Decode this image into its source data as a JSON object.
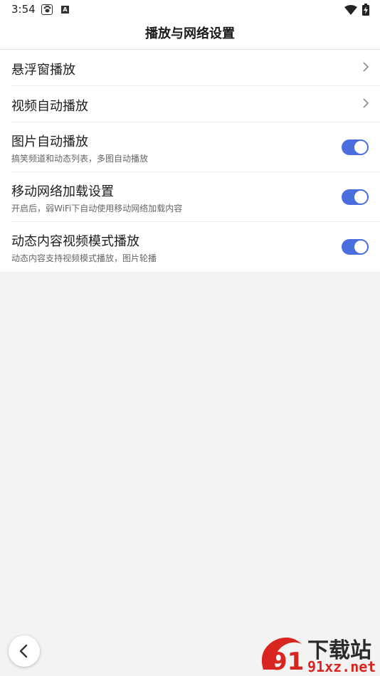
{
  "status_bar": {
    "time": "3:54",
    "app_icon_1": "baidu-paw-icon",
    "app_icon_2": "a-letter-icon",
    "app_icon_2_text": "A",
    "wifi_icon": "wifi-icon",
    "battery_icon": "battery-charging-icon"
  },
  "header": {
    "title": "播放与网络设置"
  },
  "settings": {
    "items": [
      {
        "label": "悬浮窗播放",
        "type": "nav"
      },
      {
        "label": "视频自动播放",
        "type": "nav"
      },
      {
        "label": "图片自动播放",
        "subtitle": "搞笑频道和动态列表，多图自动播放",
        "type": "toggle",
        "on": true
      },
      {
        "label": "移动网络加载设置",
        "subtitle": "开启后，弱WiFi下自动使用移动网络加载内容",
        "type": "toggle",
        "on": true
      },
      {
        "label": "动态内容视频模式播放",
        "subtitle": "动态内容支持视频模式播放，图片轮播",
        "type": "toggle",
        "on": true
      }
    ]
  },
  "colors": {
    "accent": "#4a6ee0",
    "background": "#f3f3f3",
    "watermark_red": "#d8251f"
  },
  "watermark": {
    "text_top": "下载站",
    "text_bottom": "91xz.net",
    "logo": "91-logo-icon",
    "logo_text": "91"
  },
  "nav": {
    "back_icon": "chevron-left-icon"
  }
}
